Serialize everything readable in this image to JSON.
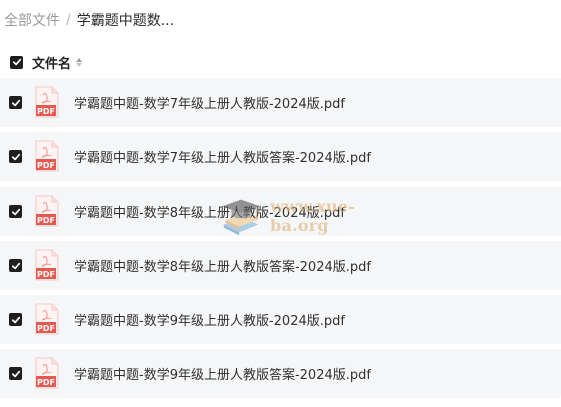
{
  "breadcrumb": {
    "root": "全部文件",
    "separator": "/",
    "current": "学霸题中题数..."
  },
  "header": {
    "select_all_checked": true,
    "column_name": "文件名"
  },
  "files": [
    {
      "name": "学霸题中题-数学7年级上册人教版-2024版.pdf",
      "checked": true,
      "type": "PDF"
    },
    {
      "name": "学霸题中题-数学7年级上册人教版答案-2024版.pdf",
      "checked": true,
      "type": "PDF"
    },
    {
      "name": "学霸题中题-数学8年级上册人教版-2024版.pdf",
      "checked": true,
      "type": "PDF"
    },
    {
      "name": "学霸题中题-数学8年级上册人教版答案-2024版.pdf",
      "checked": true,
      "type": "PDF"
    },
    {
      "name": "学霸题中题-数学9年级上册人教版-2024版.pdf",
      "checked": true,
      "type": "PDF"
    },
    {
      "name": "学霸题中题-数学9年级上册人教版答案-2024版.pdf",
      "checked": true,
      "type": "PDF"
    }
  ],
  "watermark": {
    "text": "www.xue-ba.org"
  },
  "colors": {
    "row_background": "#f5f6f7",
    "pdf_red": "#e9584f",
    "checkbox": "#1f1f1f"
  }
}
